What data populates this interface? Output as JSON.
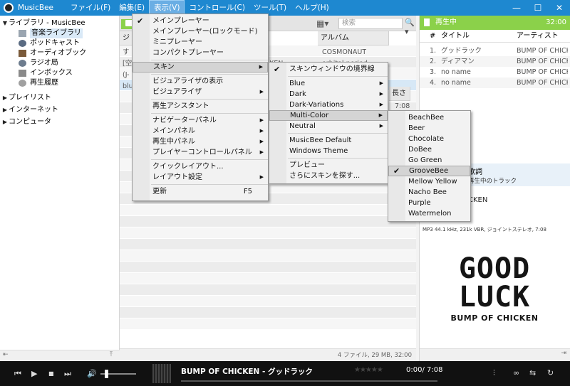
{
  "title_bar": {
    "app_title": "MusicBee",
    "menus": [
      "ファイル(F)",
      "編集(E)",
      "表示(V)",
      "コントロール(C)",
      "ツール(T)",
      "ヘルプ(H)"
    ],
    "window_controls": [
      "minimize-icon",
      "maximize-icon",
      "close-icon"
    ]
  },
  "sidebar": {
    "library": "ライブラリ - MusicBee",
    "library_items": [
      "音楽ライブラリ",
      "ポッドキャスト",
      "オーディオブック",
      "ラジオ局",
      "インボックス",
      "再生履歴"
    ],
    "groups": [
      "プレイリスト",
      "インターネット",
      "コンピュータ"
    ]
  },
  "browser": {
    "search_placeholder": "検索",
    "col_genre": "ジ",
    "col_album": "アルバム",
    "col_length": "長さ",
    "genre_cells": [
      "す",
      "[空",
      "(J-",
      "blu"
    ],
    "artist_partial": "KEN",
    "album_cells": [
      "COSMONAUT",
      "orbital period"
    ],
    "length_cells": [
      "7:08"
    ],
    "status": "4 ファイル, 29 MB, 32:00"
  },
  "now_playing": {
    "header": "再生中",
    "duration": "32:00",
    "col_num": "#",
    "col_title": "タイトル",
    "col_artist": "アーティスト",
    "tracks": [
      {
        "num": "1.",
        "title": "グッドラック",
        "artist": "BUMP OF CHICKEN"
      },
      {
        "num": "2.",
        "title": "ディアマン",
        "artist": "BUMP OF CHICKEN"
      },
      {
        "num": "3.",
        "title": "no name",
        "artist": "BUMP OF CHICKEN"
      },
      {
        "num": "4.",
        "title": "no name",
        "artist": "BUMP OF CHICKEN"
      }
    ],
    "lyrics_tab": "歌詞",
    "track_tab": "再生中のトラック",
    "artist_line": "CKEN",
    "tech_info": "MP3 44.1 kHz, 231k VBR, ジョイントステレオ, 7:08",
    "cover_line1": "GOOD",
    "cover_line2": "LUCK",
    "cover_line3": "BUMP OF CHICKEN"
  },
  "player": {
    "track": "BUMP OF CHICKEN - グッドラック",
    "time": "0:00/ 7:08",
    "rating": "★★★★★",
    "volume_level": 0.12,
    "progress": 0.0
  },
  "view_menu": {
    "items": [
      {
        "label": "メインプレーヤー",
        "checked": true
      },
      {
        "label": "メインプレーヤー(ロックモード)"
      },
      {
        "label": "ミニプレーヤー"
      },
      {
        "label": "コンパクトプレーヤー"
      },
      {
        "sep": true
      },
      {
        "label": "スキン",
        "submenu": true,
        "highlighted": true
      },
      {
        "sep": true
      },
      {
        "label": "ビジュアライザの表示"
      },
      {
        "label": "ビジュアライザ",
        "submenu": true
      },
      {
        "sep": true
      },
      {
        "label": "再生アシスタント"
      },
      {
        "sep": true
      },
      {
        "label": "ナビゲーターパネル",
        "submenu": true
      },
      {
        "label": "メインパネル",
        "submenu": true
      },
      {
        "label": "再生中パネル",
        "submenu": true
      },
      {
        "label": "プレイヤーコントロールパネル",
        "submenu": true
      },
      {
        "sep": true
      },
      {
        "label": "クイックレイアウト..."
      },
      {
        "label": "レイアウト設定",
        "submenu": true
      },
      {
        "sep": true
      },
      {
        "label": "更新",
        "shortcut": "F5"
      }
    ]
  },
  "skin_menu": {
    "items": [
      {
        "label": "スキンウィンドウの境界線",
        "checked": true
      },
      {
        "sep": true
      },
      {
        "label": "Blue",
        "submenu": true
      },
      {
        "label": "Dark",
        "submenu": true
      },
      {
        "label": "Dark-Variations",
        "submenu": true
      },
      {
        "label": "Multi-Color",
        "submenu": true,
        "highlighted": true
      },
      {
        "label": "Neutral",
        "submenu": true
      },
      {
        "sep": true
      },
      {
        "label": "MusicBee Default"
      },
      {
        "label": "Windows Theme"
      },
      {
        "sep": true
      },
      {
        "label": "プレビュー"
      },
      {
        "label": "さらにスキンを探す..."
      }
    ]
  },
  "multicolor_menu": {
    "items": [
      {
        "label": "BeachBee"
      },
      {
        "label": "Beer"
      },
      {
        "label": "Chocolate"
      },
      {
        "label": "DoBee"
      },
      {
        "label": "Go Green"
      },
      {
        "label": "GrooveBee",
        "checked": true,
        "highlighted": true
      },
      {
        "label": "Mellow Yellow"
      },
      {
        "label": "Nacho Bee"
      },
      {
        "label": "Purple"
      },
      {
        "label": "Watermelon"
      }
    ]
  },
  "colors": {
    "accent": "#1e88d0",
    "green": "#8bd14a",
    "player_bg": "#111111"
  }
}
